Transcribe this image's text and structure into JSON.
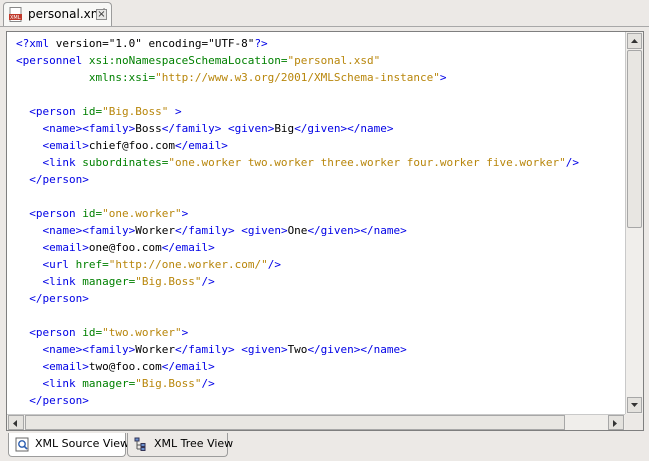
{
  "document_tab": {
    "label": "personal.xml",
    "icon": "xml-file-icon",
    "close_glyph": "×"
  },
  "editor": {
    "lines": [
      [
        {
          "t": "caret"
        },
        {
          "c": "tag",
          "s": "<?xml "
        },
        {
          "c": "txt",
          "s": "version=\"1.0\" encoding=\"UTF-8\""
        },
        {
          "c": "tag",
          "s": "?>"
        }
      ],
      [
        {
          "c": "tag",
          "s": "<personnel "
        },
        {
          "c": "attr",
          "s": "xsi:noNamespaceSchemaLocation="
        },
        {
          "c": "val",
          "s": "\"personal.xsd\""
        }
      ],
      [
        {
          "c": "txt",
          "s": "           "
        },
        {
          "c": "attr",
          "s": "xmlns:xsi="
        },
        {
          "c": "val",
          "s": "\"http://www.w3.org/2001/XMLSchema-instance\""
        },
        {
          "c": "tag",
          "s": ">"
        }
      ],
      [],
      [
        {
          "c": "txt",
          "s": "  "
        },
        {
          "c": "tag",
          "s": "<person "
        },
        {
          "c": "attr",
          "s": "id="
        },
        {
          "c": "val",
          "s": "\"Big.Boss\""
        },
        {
          "c": "tag",
          "s": " >"
        }
      ],
      [
        {
          "c": "txt",
          "s": "    "
        },
        {
          "c": "tag",
          "s": "<name><family>"
        },
        {
          "c": "txt",
          "s": "Boss"
        },
        {
          "c": "tag",
          "s": "</family>"
        },
        {
          "c": "txt",
          "s": " "
        },
        {
          "c": "tag",
          "s": "<given>"
        },
        {
          "c": "txt",
          "s": "Big"
        },
        {
          "c": "tag",
          "s": "</given></name>"
        }
      ],
      [
        {
          "c": "txt",
          "s": "    "
        },
        {
          "c": "tag",
          "s": "<email>"
        },
        {
          "c": "txt",
          "s": "chief@foo.com"
        },
        {
          "c": "tag",
          "s": "</email>"
        }
      ],
      [
        {
          "c": "txt",
          "s": "    "
        },
        {
          "c": "tag",
          "s": "<link "
        },
        {
          "c": "attr",
          "s": "subordinates="
        },
        {
          "c": "val",
          "s": "\"one.worker two.worker three.worker four.worker five.worker\""
        },
        {
          "c": "tag",
          "s": "/>"
        }
      ],
      [
        {
          "c": "txt",
          "s": "  "
        },
        {
          "c": "tag",
          "s": "</person>"
        }
      ],
      [],
      [
        {
          "c": "txt",
          "s": "  "
        },
        {
          "c": "tag",
          "s": "<person "
        },
        {
          "c": "attr",
          "s": "id="
        },
        {
          "c": "val",
          "s": "\"one.worker\""
        },
        {
          "c": "tag",
          "s": ">"
        }
      ],
      [
        {
          "c": "txt",
          "s": "    "
        },
        {
          "c": "tag",
          "s": "<name><family>"
        },
        {
          "c": "txt",
          "s": "Worker"
        },
        {
          "c": "tag",
          "s": "</family>"
        },
        {
          "c": "txt",
          "s": " "
        },
        {
          "c": "tag",
          "s": "<given>"
        },
        {
          "c": "txt",
          "s": "One"
        },
        {
          "c": "tag",
          "s": "</given></name>"
        }
      ],
      [
        {
          "c": "txt",
          "s": "    "
        },
        {
          "c": "tag",
          "s": "<email>"
        },
        {
          "c": "txt",
          "s": "one@foo.com"
        },
        {
          "c": "tag",
          "s": "</email>"
        }
      ],
      [
        {
          "c": "txt",
          "s": "    "
        },
        {
          "c": "tag",
          "s": "<url "
        },
        {
          "c": "attr",
          "s": "href="
        },
        {
          "c": "val",
          "s": "\"http://one.worker.com/\""
        },
        {
          "c": "tag",
          "s": "/>"
        }
      ],
      [
        {
          "c": "txt",
          "s": "    "
        },
        {
          "c": "tag",
          "s": "<link "
        },
        {
          "c": "attr",
          "s": "manager="
        },
        {
          "c": "val",
          "s": "\"Big.Boss\""
        },
        {
          "c": "tag",
          "s": "/>"
        }
      ],
      [
        {
          "c": "txt",
          "s": "  "
        },
        {
          "c": "tag",
          "s": "</person>"
        }
      ],
      [],
      [
        {
          "c": "txt",
          "s": "  "
        },
        {
          "c": "tag",
          "s": "<person "
        },
        {
          "c": "attr",
          "s": "id="
        },
        {
          "c": "val",
          "s": "\"two.worker\""
        },
        {
          "c": "tag",
          "s": ">"
        }
      ],
      [
        {
          "c": "txt",
          "s": "    "
        },
        {
          "c": "tag",
          "s": "<name><family>"
        },
        {
          "c": "txt",
          "s": "Worker"
        },
        {
          "c": "tag",
          "s": "</family>"
        },
        {
          "c": "txt",
          "s": " "
        },
        {
          "c": "tag",
          "s": "<given>"
        },
        {
          "c": "txt",
          "s": "Two"
        },
        {
          "c": "tag",
          "s": "</given></name>"
        }
      ],
      [
        {
          "c": "txt",
          "s": "    "
        },
        {
          "c": "tag",
          "s": "<email>"
        },
        {
          "c": "txt",
          "s": "two@foo.com"
        },
        {
          "c": "tag",
          "s": "</email>"
        }
      ],
      [
        {
          "c": "txt",
          "s": "    "
        },
        {
          "c": "tag",
          "s": "<link "
        },
        {
          "c": "attr",
          "s": "manager="
        },
        {
          "c": "val",
          "s": "\"Big.Boss\""
        },
        {
          "c": "tag",
          "s": "/>"
        }
      ],
      [
        {
          "c": "txt",
          "s": "  "
        },
        {
          "c": "tag",
          "s": "</person>"
        }
      ]
    ],
    "colors": {
      "tag": "#0000e6",
      "attribute": "#008000",
      "value": "#b8860b",
      "text": "#000000"
    }
  },
  "view_tabs": [
    {
      "label": "XML Source View",
      "icon": "xml-source-view-icon",
      "active": true
    },
    {
      "label": "XML Tree View",
      "icon": "xml-tree-view-icon",
      "active": false
    }
  ]
}
